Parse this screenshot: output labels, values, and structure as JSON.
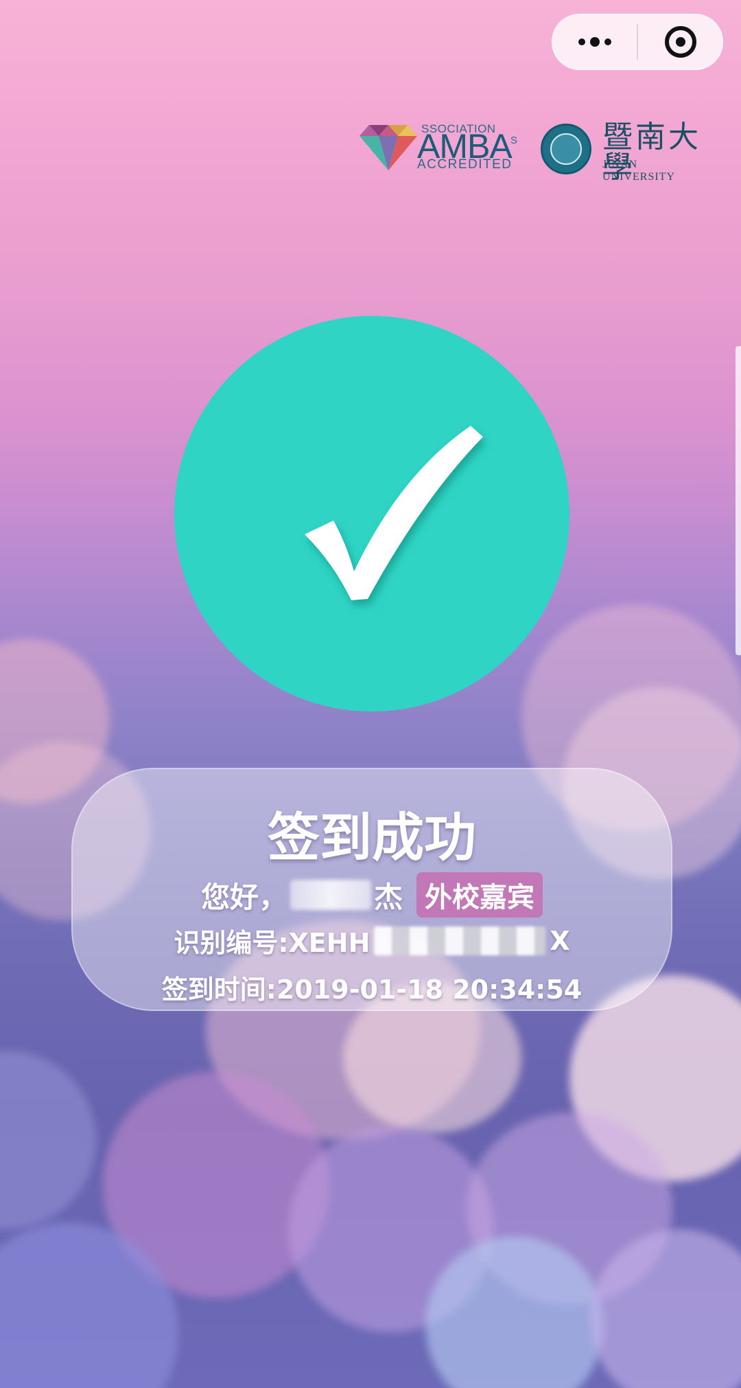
{
  "menu": {
    "more_icon": "more-dots-icon",
    "close_icon": "target-circle-icon"
  },
  "logos": {
    "amba": {
      "top_text": "SSOCIATION",
      "side_text": "S",
      "brand": "AMBA",
      "accredited": "ACCREDITED"
    },
    "jnu": {
      "chinese_name": "暨南大學",
      "english_name": "JINAN UNIVERSITY"
    }
  },
  "status": {
    "icon": "checkmark-icon",
    "accent_color": "#2fd4c4",
    "title": "签到成功",
    "greeting_prefix": "您好，",
    "name_suffix": "杰",
    "guest_badge": "外校嘉宾",
    "badge_color": "#c277b6",
    "id_label": "识别编号:XEHH",
    "id_suffix": "X",
    "checkin_time": "签到时间:2019-01-18 20:34:54"
  }
}
